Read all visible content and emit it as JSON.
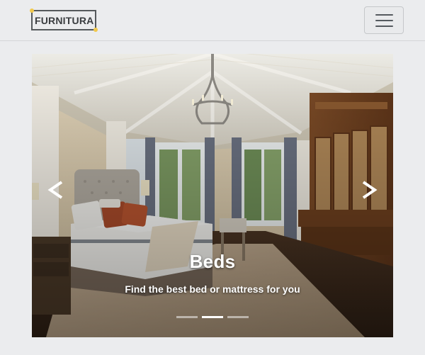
{
  "navbar": {
    "brand_text": "FURNITURA",
    "brand_accent_color": "#f2c94c",
    "toggler_icon": "hamburger-menu-icon"
  },
  "carousel": {
    "slide": {
      "title": "Beds",
      "caption": "Find the best bed or mattress for you"
    },
    "prev_icon": "chevron-left-icon",
    "next_icon": "chevron-right-icon",
    "indicator_count": 3,
    "active_indicator": 2
  }
}
